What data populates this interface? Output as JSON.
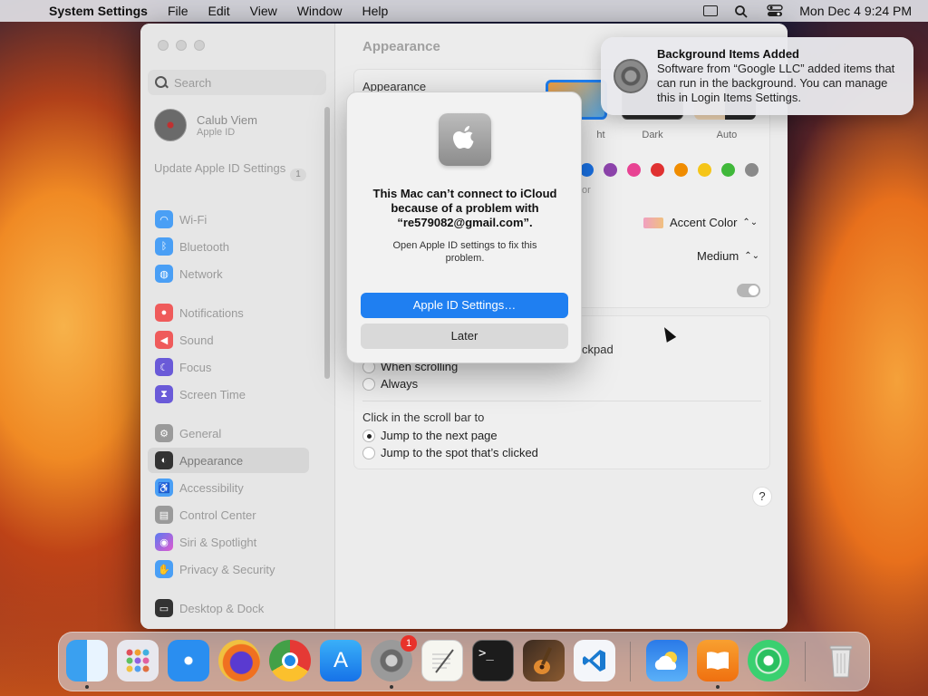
{
  "menubar": {
    "app": "System Settings",
    "items": [
      "File",
      "Edit",
      "View",
      "Window",
      "Help"
    ],
    "clock": "Mon Dec 4  9:24 PM"
  },
  "sidebar": {
    "search_placeholder": "Search",
    "account": {
      "name": "Calub Viem",
      "sub": "Apple ID"
    },
    "update": {
      "label": "Update Apple ID Settings",
      "badge": "1"
    },
    "items": [
      {
        "label": "Wi-Fi",
        "icon": "wifi-icon",
        "color": "#4a9ff5"
      },
      {
        "label": "Bluetooth",
        "icon": "bluetooth-icon",
        "color": "#4a9ff5"
      },
      {
        "label": "Network",
        "icon": "network-icon",
        "color": "#4a9ff5"
      },
      {
        "label": "Notifications",
        "icon": "bell-icon",
        "color": "#ef5b5b"
      },
      {
        "label": "Sound",
        "icon": "speaker-icon",
        "color": "#ef5b5b"
      },
      {
        "label": "Focus",
        "icon": "moon-icon",
        "color": "#6a5ad8"
      },
      {
        "label": "Screen Time",
        "icon": "hourglass-icon",
        "color": "#6a5ad8"
      },
      {
        "label": "General",
        "icon": "gear-icon",
        "color": "#9a9a9a"
      },
      {
        "label": "Appearance",
        "icon": "appearance-icon",
        "color": "#333333"
      },
      {
        "label": "Accessibility",
        "icon": "accessibility-icon",
        "color": "#4a9ff5"
      },
      {
        "label": "Control Center",
        "icon": "control-center-icon",
        "color": "#9a9a9a"
      },
      {
        "label": "Siri & Spotlight",
        "icon": "siri-icon",
        "color": "#c054d8"
      },
      {
        "label": "Privacy & Security",
        "icon": "hand-icon",
        "color": "#4a9ff5"
      },
      {
        "label": "Desktop & Dock",
        "icon": "dock-icon",
        "color": "#333333"
      }
    ]
  },
  "main": {
    "title": "Appearance",
    "appearance_label": "Appearance",
    "themes": [
      "ht",
      "Dark",
      "Auto"
    ],
    "accent_colors": [
      "#1a73e8",
      "#8e44ad",
      "#e84393",
      "#e03131",
      "#f08c00",
      "#f5c518",
      "#40b83a",
      "#8a8a8a"
    ],
    "accent_fragment": "or",
    "highlight_value": "Accent Color",
    "sidebar_icon_size": "Medium",
    "scroll_fragment": "ckpad",
    "scroll_options": [
      "When scrolling",
      "Always"
    ],
    "click_label": "Click in the scroll bar to",
    "click_options": [
      "Jump to the next page",
      "Jump to the spot that’s clicked"
    ],
    "help": "?"
  },
  "dialog": {
    "title": "This Mac can’t connect to iCloud because of a problem with “re579082@gmail.com”.",
    "body": "Open Apple ID settings to fix this problem.",
    "primary": "Apple ID Settings…",
    "secondary": "Later"
  },
  "notification": {
    "title": "Background Items Added",
    "body": "Software from “Google LLC” added items that can run in the background. You can manage this in Login Items Settings."
  },
  "dock": {
    "apps": [
      "finder",
      "launchpad",
      "safari",
      "firefox",
      "chrome",
      "app-store",
      "system-settings",
      "textedit",
      "terminal",
      "garageband",
      "vscode",
      "weather",
      "books",
      "find-my",
      "trash"
    ],
    "settings_badge": "1"
  }
}
